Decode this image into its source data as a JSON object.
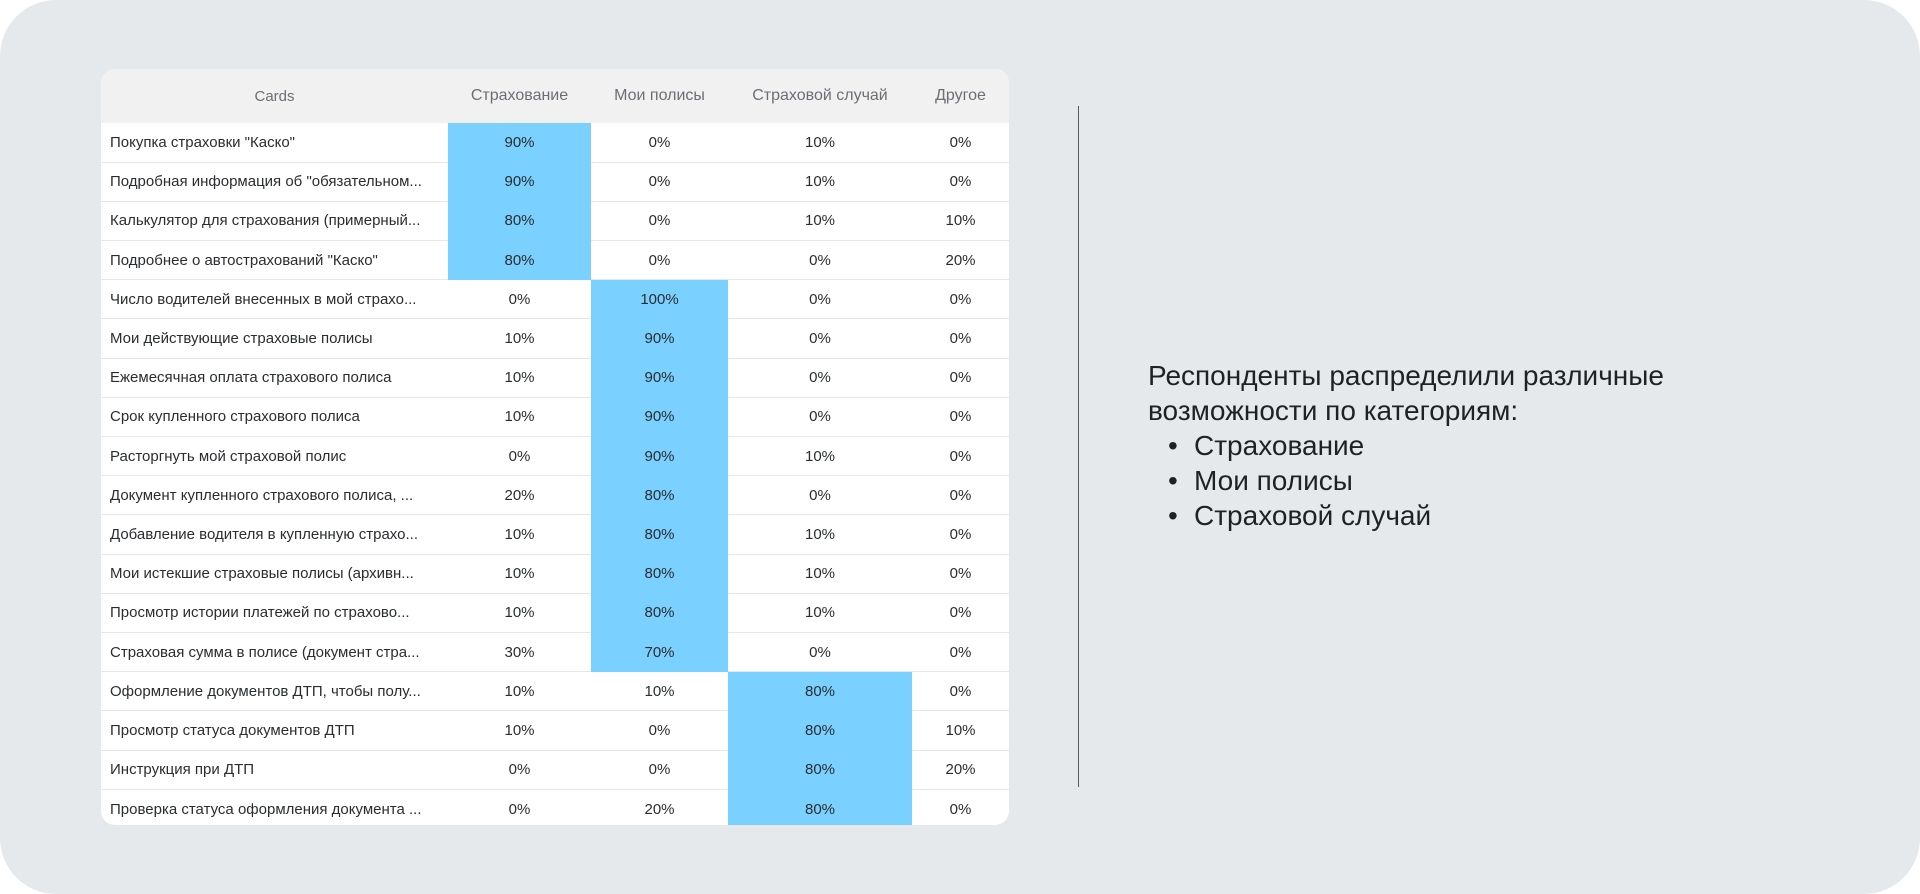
{
  "table": {
    "headers": [
      "Cards",
      "Страхование",
      "Мои полисы",
      "Страховой случай",
      "Другое"
    ],
    "highlight_color": "#7ad0ff",
    "rows": [
      {
        "name": "Покупка страховки \"Каско\"",
        "values": [
          "90%",
          "0%",
          "10%",
          "0%"
        ],
        "highlight": 0
      },
      {
        "name": "Подробная информация об \"обязательном...",
        "values": [
          "90%",
          "0%",
          "10%",
          "0%"
        ],
        "highlight": 0
      },
      {
        "name": "Калькулятор для страхования (примерный...",
        "values": [
          "80%",
          "0%",
          "10%",
          "10%"
        ],
        "highlight": 0
      },
      {
        "name": "Подробнее о автострахований \"Каско\"",
        "values": [
          "80%",
          "0%",
          "0%",
          "20%"
        ],
        "highlight": 0
      },
      {
        "name": "Число водителей внесенных в мой страхо...",
        "values": [
          "0%",
          "100%",
          "0%",
          "0%"
        ],
        "highlight": 1
      },
      {
        "name": "Мои действующие страховые полисы",
        "values": [
          "10%",
          "90%",
          "0%",
          "0%"
        ],
        "highlight": 1
      },
      {
        "name": "Ежемесячная оплата страхового полиса",
        "values": [
          "10%",
          "90%",
          "0%",
          "0%"
        ],
        "highlight": 1
      },
      {
        "name": "Срок купленного страхового полиса",
        "values": [
          "10%",
          "90%",
          "0%",
          "0%"
        ],
        "highlight": 1
      },
      {
        "name": "Расторгнуть мой страховой полис",
        "values": [
          "0%",
          "90%",
          "10%",
          "0%"
        ],
        "highlight": 1
      },
      {
        "name": "Документ купленного страхового полиса, ...",
        "values": [
          "20%",
          "80%",
          "0%",
          "0%"
        ],
        "highlight": 1
      },
      {
        "name": "Добавление водителя в купленную страхо...",
        "values": [
          "10%",
          "80%",
          "10%",
          "0%"
        ],
        "highlight": 1
      },
      {
        "name": "Мои истекшие страховые полисы (архивн...",
        "values": [
          "10%",
          "80%",
          "10%",
          "0%"
        ],
        "highlight": 1
      },
      {
        "name": "Просмотр истории платежей по страхово...",
        "values": [
          "10%",
          "80%",
          "10%",
          "0%"
        ],
        "highlight": 1
      },
      {
        "name": "Страховая сумма в полисе (документ стра...",
        "values": [
          "30%",
          "70%",
          "0%",
          "0%"
        ],
        "highlight": 1
      },
      {
        "name": "Оформление документов ДТП, чтобы полу...",
        "values": [
          "10%",
          "10%",
          "80%",
          "0%"
        ],
        "highlight": 2
      },
      {
        "name": "Просмотр статуса документов ДТП",
        "values": [
          "10%",
          "0%",
          "80%",
          "10%"
        ],
        "highlight": 2
      },
      {
        "name": "Инструкция при ДТП",
        "values": [
          "0%",
          "0%",
          "80%",
          "20%"
        ],
        "highlight": 2
      },
      {
        "name": "Проверка статуса оформления документа ...",
        "values": [
          "0%",
          "20%",
          "80%",
          "0%"
        ],
        "highlight": 2
      }
    ]
  },
  "summary": {
    "intro": "Респонденты распределили различные возможности по категориям:",
    "bullet_glyph": "•",
    "items": [
      "Страхование",
      "Мои полисы",
      "Страховой случай"
    ]
  }
}
